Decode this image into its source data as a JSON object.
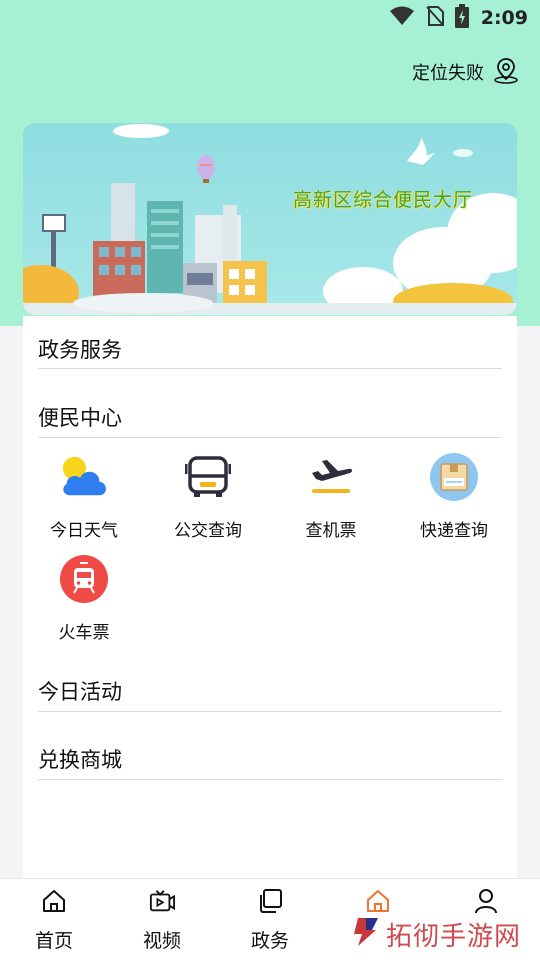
{
  "status_bar": {
    "time": "2:09",
    "icons": [
      "wifi-icon",
      "no-sim-icon",
      "battery-charging-icon"
    ]
  },
  "header": {
    "location_text": "定位失败",
    "location_icon": "location-pin-icon"
  },
  "banner": {
    "title": "高新区综合便民大厅"
  },
  "sections": {
    "gov_services": "政务服务",
    "convenience_center": "便民中心",
    "today_activities": "今日活动",
    "exchange_mall": "兑换商城"
  },
  "services": [
    {
      "label": "今日天气",
      "icon": "weather-icon"
    },
    {
      "label": "公交查询",
      "icon": "bus-icon"
    },
    {
      "label": "查机票",
      "icon": "airplane-icon"
    },
    {
      "label": "快递查询",
      "icon": "parcel-icon"
    },
    {
      "label": "火车票",
      "icon": "train-icon"
    }
  ],
  "tabbar": {
    "items": [
      {
        "label": "首页",
        "icon": "home-outline-icon"
      },
      {
        "label": "视频",
        "icon": "video-icon"
      },
      {
        "label": "政务",
        "icon": "copy-icon"
      },
      {
        "label": "",
        "icon": "home-active-icon"
      },
      {
        "label": "",
        "icon": "person-icon"
      }
    ],
    "active_color": "#f0742f"
  },
  "watermark": {
    "text": "拓彻手游网"
  },
  "colors": {
    "top_background": "#a6f1d3",
    "accent": "#f0742f"
  }
}
